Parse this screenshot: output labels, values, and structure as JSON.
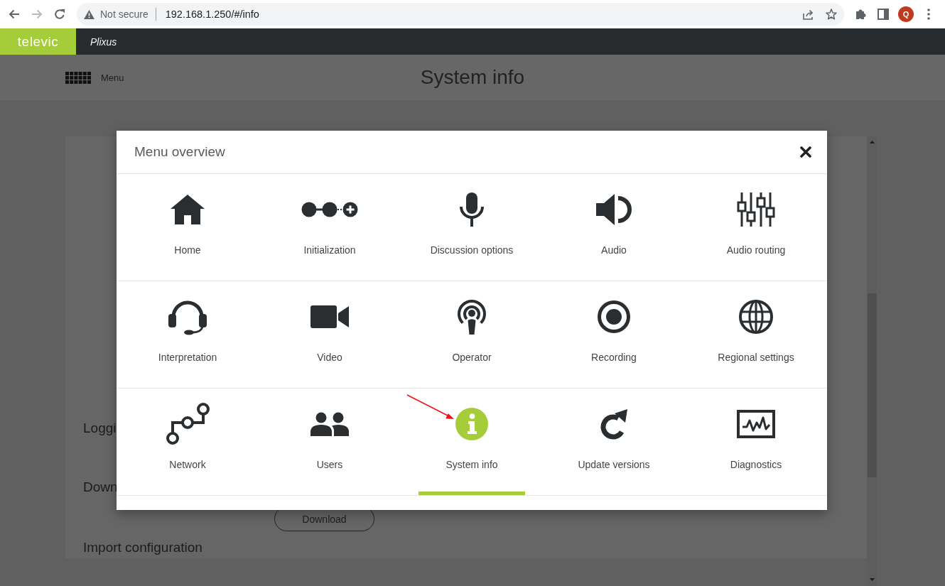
{
  "browser": {
    "forward_disabled": true,
    "security_label": "Not secure",
    "url": "192.168.1.250/#/info",
    "profile_initial": "Q"
  },
  "app_header": {
    "logo": "televic",
    "product": "Plixus"
  },
  "page": {
    "menu_label": "Menu",
    "title": "System info",
    "sections": [
      {
        "label": "Loggi"
      },
      {
        "label": "Down"
      }
    ],
    "download_button": "Download",
    "next_section": "Import configuration"
  },
  "menu_overview": {
    "title": "Menu overview",
    "items": [
      {
        "label": "Home",
        "selected": false
      },
      {
        "label": "Initialization",
        "selected": false
      },
      {
        "label": "Discussion options",
        "selected": false
      },
      {
        "label": "Audio",
        "selected": false
      },
      {
        "label": "Audio routing",
        "selected": false
      },
      {
        "label": "Interpretation",
        "selected": false
      },
      {
        "label": "Video",
        "selected": false
      },
      {
        "label": "Operator",
        "selected": false
      },
      {
        "label": "Recording",
        "selected": false
      },
      {
        "label": "Regional settings",
        "selected": false
      },
      {
        "label": "Network",
        "selected": false
      },
      {
        "label": "Users",
        "selected": false
      },
      {
        "label": "System info",
        "selected": true
      },
      {
        "label": "Update versions",
        "selected": false
      },
      {
        "label": "Diagnostics",
        "selected": false
      }
    ]
  }
}
